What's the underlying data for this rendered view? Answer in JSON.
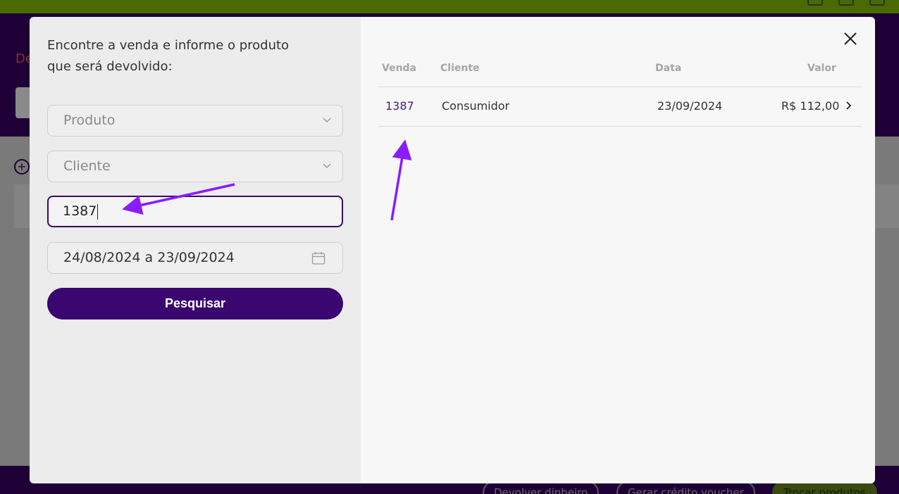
{
  "modal": {
    "instructions": "Encontre a venda e informe o produto\nque será devolvido:",
    "filters": {
      "product_placeholder": "Produto",
      "client_placeholder": "Cliente",
      "sale_value": "1387",
      "date_range": "24/08/2024 a 23/09/2024"
    },
    "search_label": "Pesquisar",
    "table": {
      "headers": {
        "sale": "Venda",
        "client": "Cliente",
        "date": "Data",
        "value": "Valor"
      },
      "rows": [
        {
          "sale": "1387",
          "client": "Consumidor",
          "date": "23/09/2024",
          "value": "R$ 112,00"
        }
      ]
    }
  },
  "background": {
    "heading_fragment": "De",
    "bottom_buttons": [
      "Devolver dinheiro",
      "Gerar crédito voucher",
      "Trocar produtos"
    ]
  },
  "colors": {
    "primary": "#3a0670",
    "annotation_arrow": "#8a1cff",
    "topbar": "#4a6a00"
  },
  "icons": [
    "chevron-down-icon",
    "calendar-icon",
    "close-icon",
    "chevron-right-icon",
    "plus-circle-icon"
  ]
}
